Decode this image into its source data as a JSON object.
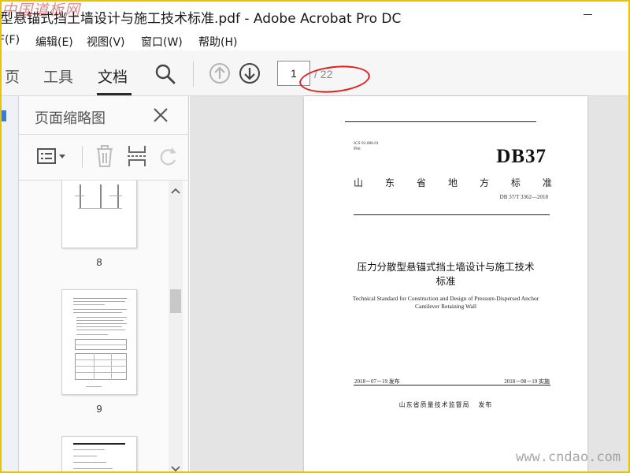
{
  "window": {
    "title": "型悬锚式挡土墙设计与施工技术标准.pdf - Adobe Acrobat Pro DC",
    "watermark_top": "中国道板网",
    "watermark_bottom": "www.cndao.com"
  },
  "menu": {
    "items": [
      "F(F)",
      "编辑(E)",
      "视图(V)",
      "窗口(W)",
      "帮助(H)"
    ]
  },
  "toolbar": {
    "tabs": [
      "页",
      "工具",
      "文档"
    ],
    "active_tab": "文档",
    "current_page": "1",
    "total_pages": "/ 22"
  },
  "thumbnails": {
    "panel_title": "页面缩略图",
    "pages": [
      "8",
      "9"
    ]
  },
  "document": {
    "ics": "ICS 93.080.01",
    "code": "P66",
    "db": "DB37",
    "province_chars": [
      "山",
      "东",
      "省",
      "地",
      "方",
      "标",
      "准"
    ],
    "standard_no": "DB 37/T 3362—2018",
    "title_cn_line1": "压力分散型悬锚式挡土墙设计与施工技术",
    "title_cn_line2": "标准",
    "title_en_line1": "Technical Standard for Construction and Design of Pressure-Dispersed Anchor",
    "title_en_line2": "Cantilever Retaining Wall",
    "release_date": "2018－07－19 发布",
    "impl_date": "2018－08－19 实施",
    "issuer": "山东省质量技术监督局",
    "issue_word": "发布"
  },
  "colors": {
    "annotation": "#e02020",
    "frame": "#e6c400"
  }
}
